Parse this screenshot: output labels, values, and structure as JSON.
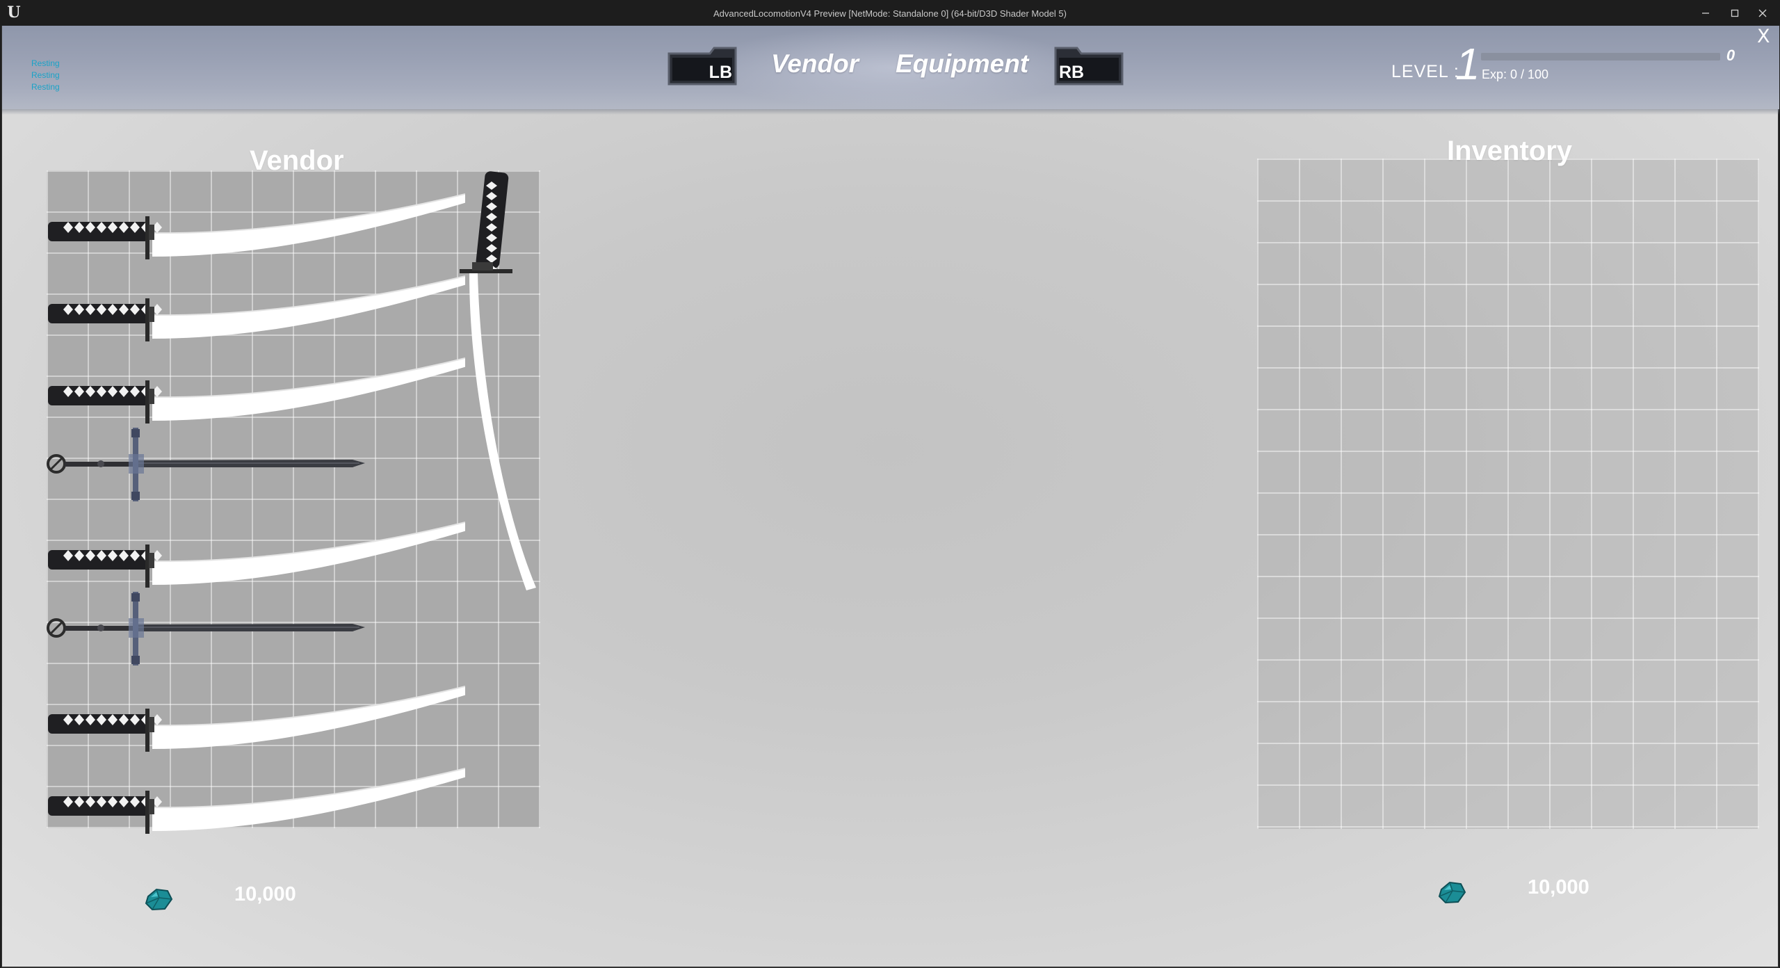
{
  "window": {
    "title": "AdvancedLocomotionV4 Preview [NetMode: Standalone 0]  (64-bit/D3D Shader Model 5)",
    "logo_icon": "unreal-engine-logo",
    "controls": [
      "minimize-icon",
      "maximize-icon",
      "close-icon"
    ]
  },
  "hud": {
    "status_lines": [
      "Resting",
      "Resting",
      "Resting"
    ],
    "left_bumper": "LB",
    "right_bumper": "RB",
    "tabs": [
      {
        "label": "Vendor",
        "active": true
      },
      {
        "label": "Equipment",
        "active": false
      }
    ],
    "level_label": "LEVEL :",
    "level_value": "1",
    "exp_bar_value": "0",
    "exp_progress": 0,
    "exp_text": "Exp: 0 / 100",
    "close_label": "X"
  },
  "vendor": {
    "title": "Vendor",
    "items": [
      {
        "type": "katana",
        "icon": "katana-icon"
      },
      {
        "type": "katana",
        "icon": "katana-icon"
      },
      {
        "type": "katana",
        "icon": "katana-icon"
      },
      {
        "type": "longsword",
        "icon": "longsword-icon"
      },
      {
        "type": "katana",
        "icon": "katana-icon"
      },
      {
        "type": "longsword",
        "icon": "longsword-icon"
      },
      {
        "type": "katana",
        "icon": "katana-icon"
      },
      {
        "type": "katana",
        "icon": "katana-icon"
      },
      {
        "type": "katana-vertical",
        "icon": "katana-icon"
      }
    ],
    "currency": {
      "icon": "gem-icon",
      "value": "10,000"
    }
  },
  "inventory": {
    "title": "Inventory",
    "items": [],
    "currency": {
      "icon": "gem-icon",
      "value": "10,000"
    }
  },
  "colors": {
    "header_band": "#9aa1b4",
    "status_text": "#1aa3c8",
    "gem": "#1b8d96"
  }
}
